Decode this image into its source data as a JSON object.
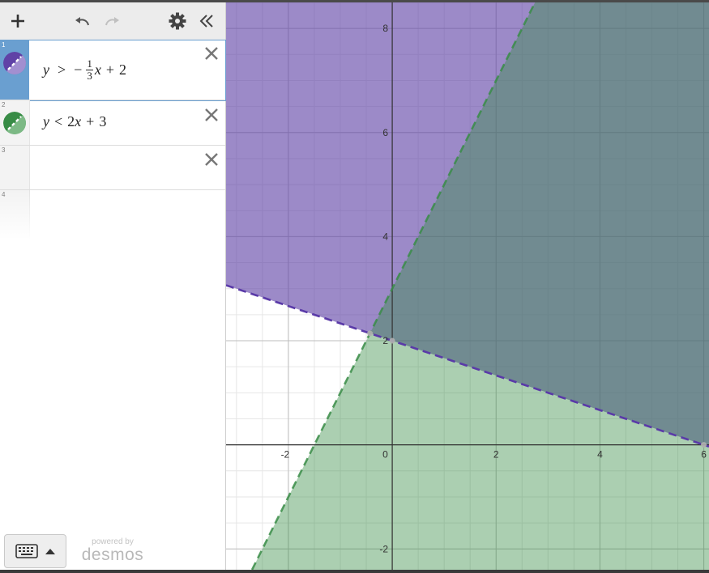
{
  "toolbar": {
    "add_icon": "plus-icon",
    "undo_icon": "undo-icon",
    "redo_icon": "redo-icon",
    "settings_icon": "gear-icon",
    "collapse_icon": "double-chevron-left-icon"
  },
  "expressions": [
    {
      "index": "1",
      "parts": {
        "y": "y",
        "op": ">",
        "minus": "−",
        "num": "1",
        "den": "3",
        "x": "x",
        "plus": "+",
        "c": "2"
      },
      "color": "#6042a6",
      "active": true
    },
    {
      "index": "2",
      "parts": {
        "y": "y",
        "op": "<",
        "coef": "2",
        "x": "x",
        "plus": "+",
        "c": "3"
      },
      "color": "#388c46",
      "active": false
    },
    {
      "index": "3",
      "text": ""
    },
    {
      "index": "4",
      "text": ""
    }
  ],
  "keyboard": {
    "icon": "keyboard-icon",
    "toggle_icon": "caret-up-icon"
  },
  "branding": {
    "powered_by": "powered by",
    "name": "desmos"
  },
  "graph": {
    "x_ticks": [
      "-2",
      "0",
      "2",
      "4",
      "6"
    ],
    "y_ticks": [
      "8",
      "6",
      "4",
      "2",
      "-2"
    ],
    "x_range": [
      -3.2,
      6.1
    ],
    "y_range": [
      -2.4,
      8.5
    ],
    "inequality_1": {
      "type": "y >",
      "slope": -0.3333,
      "intercept": 2,
      "boundary": "dashed",
      "shade": "above",
      "color": "#6042a6"
    },
    "inequality_2": {
      "type": "y <",
      "slope": 2,
      "intercept": 3,
      "boundary": "dashed",
      "shade": "below",
      "color": "#388c46"
    }
  }
}
